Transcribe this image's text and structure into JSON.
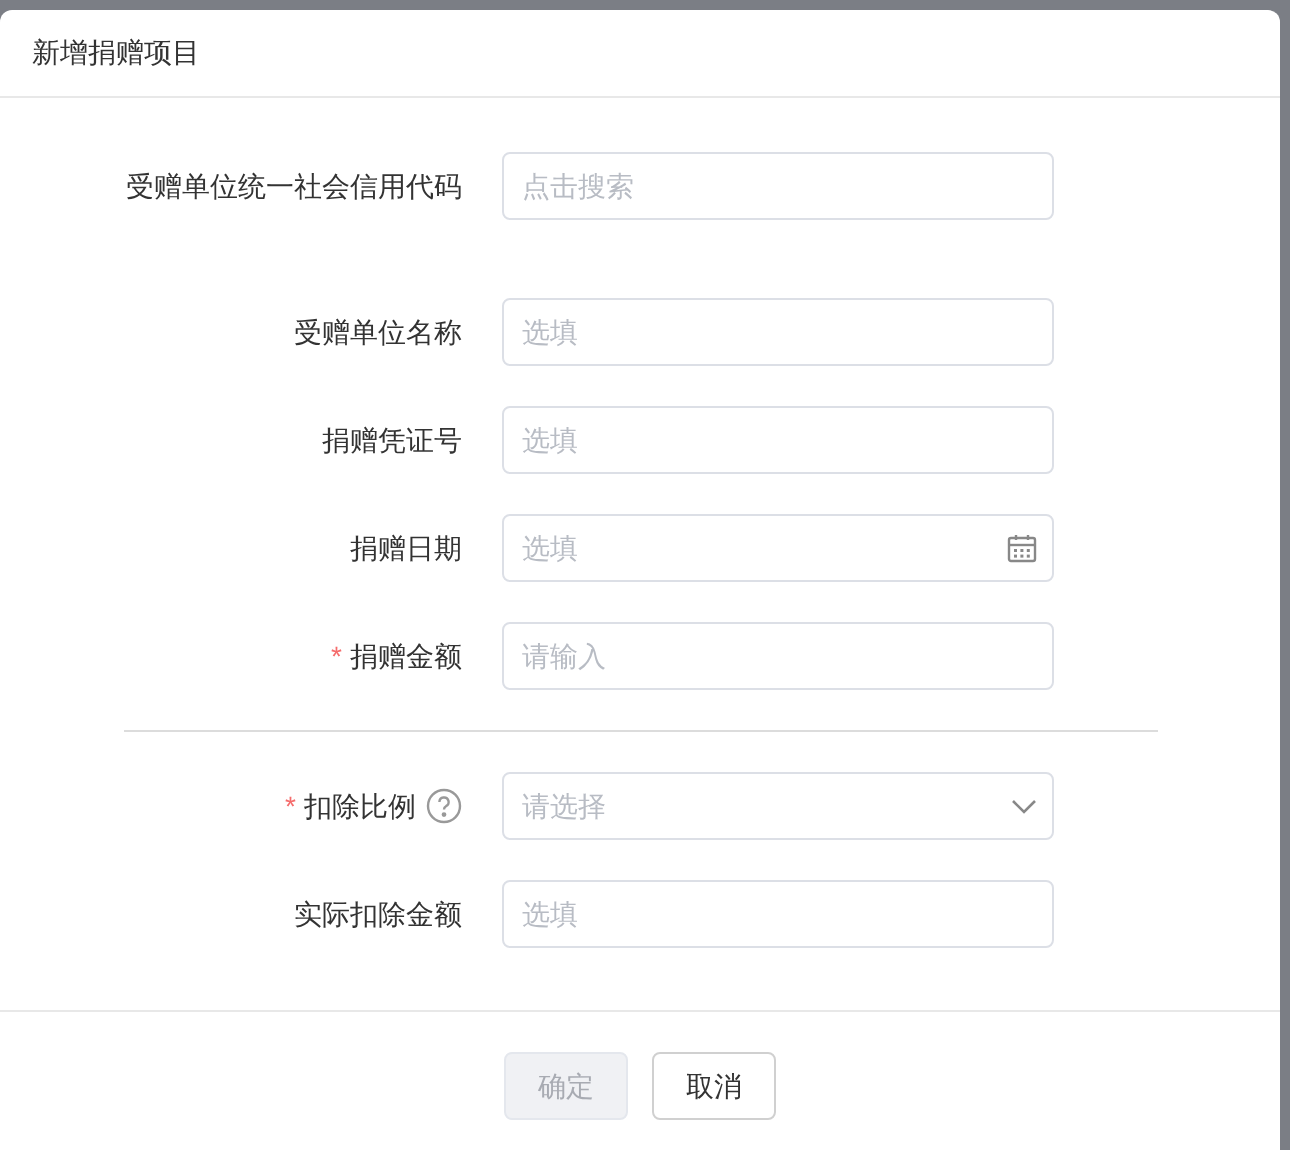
{
  "dialog": {
    "title": "新增捐赠项目"
  },
  "groups": [
    {
      "fields": [
        {
          "label": "受赠单位统一社会信用代码",
          "kind": "search",
          "placeholder": "点击搜索",
          "help": false
        }
      ]
    },
    {
      "fields": [
        {
          "label": "受赠单位名称",
          "kind": "text",
          "placeholder": "选填",
          "help": false
        },
        {
          "label": "捐赠凭证号",
          "kind": "text",
          "placeholder": "选填",
          "help": false
        },
        {
          "label": "捐赠日期",
          "kind": "date",
          "placeholder": "选填",
          "help": false
        },
        {
          "label": "捐赠金额",
          "kind": "text",
          "placeholder": "请输入",
          "required_mark": "*",
          "help": false
        }
      ]
    },
    {
      "fields": [
        {
          "label": "扣除比例",
          "kind": "select",
          "placeholder": "请选择",
          "required_mark": "*",
          "help": true
        },
        {
          "label": "实际扣除金额",
          "kind": "text",
          "placeholder": "选填",
          "help": false
        }
      ]
    }
  ],
  "buttons": [
    {
      "label": "确定",
      "disabled": true
    },
    {
      "label": "取消",
      "disabled": false
    }
  ]
}
